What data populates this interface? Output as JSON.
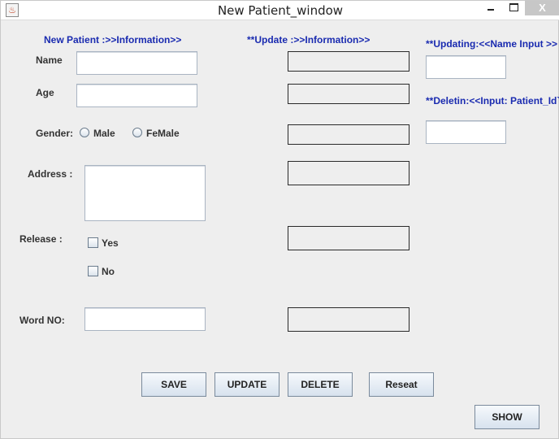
{
  "window": {
    "title": "New Patient_window",
    "close_glyph": "X"
  },
  "headers": {
    "new_patient": "New Patient  :>>Information>>",
    "update": "**Update :>>Information>>",
    "updating": "**Updating:<<Name Input >> *",
    "deleting": "**Deletin:<<Input: Patient_Id`"
  },
  "form": {
    "name_label": "Name",
    "name_value": "",
    "age_label": "Age",
    "age_value": "",
    "gender_label": "Gender:",
    "gender_options": [
      "Male",
      "FeMale"
    ],
    "gender_selected": "",
    "address_label": "Address :",
    "address_value": "",
    "release_label": "Release :",
    "release_yes": "Yes",
    "release_no": "No",
    "release_yes_checked": false,
    "release_no_checked": false,
    "word_no_label": "Word NO:",
    "word_no_value": ""
  },
  "buttons": {
    "save": "SAVE",
    "update": "UPDATE",
    "delete": "DELETE",
    "reset": "Reseat",
    "show": "SHOW"
  },
  "colors": {
    "accent_text": "#1a2bb0",
    "background": "#eeeeee"
  }
}
